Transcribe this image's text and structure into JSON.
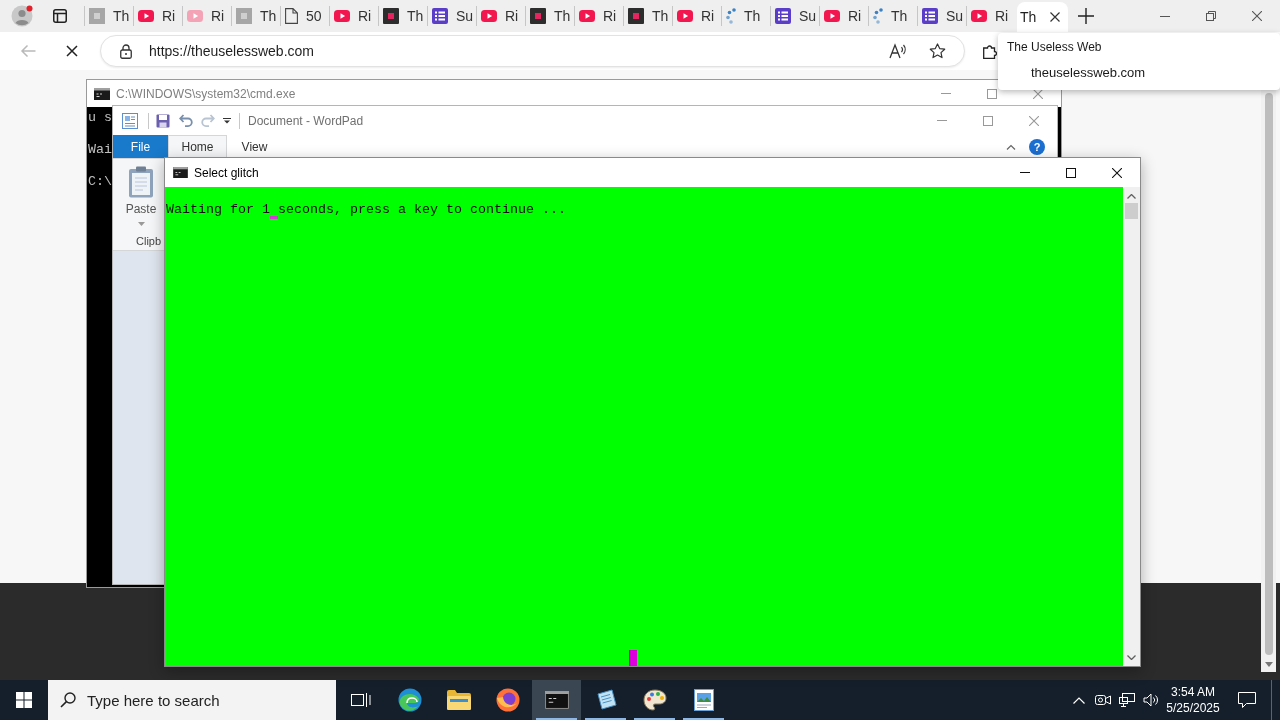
{
  "browser": {
    "tabs": [
      {
        "label": "Th",
        "kind": "grey-tile",
        "selected": false
      },
      {
        "label": "Ri",
        "kind": "play",
        "selected": false
      },
      {
        "label": "Ri",
        "kind": "play-faded",
        "selected": false
      },
      {
        "label": "Th",
        "kind": "grey-tile",
        "selected": false
      },
      {
        "label": "50",
        "kind": "document",
        "selected": false
      },
      {
        "label": "Ri",
        "kind": "play",
        "selected": false
      },
      {
        "label": "Th",
        "kind": "dark-tile",
        "selected": false
      },
      {
        "label": "Su",
        "kind": "list",
        "selected": false
      },
      {
        "label": "Ri",
        "kind": "play",
        "selected": false
      },
      {
        "label": "Th",
        "kind": "dark-tile",
        "selected": false
      },
      {
        "label": "Ri",
        "kind": "play",
        "selected": false
      },
      {
        "label": "Th",
        "kind": "dark-tile",
        "selected": false
      },
      {
        "label": "Ri",
        "kind": "play",
        "selected": false
      },
      {
        "label": "Th",
        "kind": "dots",
        "selected": false
      },
      {
        "label": "Su",
        "kind": "list",
        "selected": false
      },
      {
        "label": "Ri",
        "kind": "play",
        "selected": false
      },
      {
        "label": "Th",
        "kind": "dots",
        "selected": false
      },
      {
        "label": "Su",
        "kind": "list",
        "selected": false
      },
      {
        "label": "Ri",
        "kind": "play",
        "selected": false
      },
      {
        "label": "Th",
        "kind": "blank",
        "selected": true
      }
    ],
    "address_bar": {
      "url": "https://theuselessweb.com"
    },
    "hover_card": {
      "title": "The Useless Web",
      "domain": "theuselessweb.com"
    }
  },
  "cmd_window": {
    "title": "C:\\WINDOWS\\system32\\cmd.exe",
    "lines": [
      "u s",
      "Wai",
      "C:\\"
    ]
  },
  "wordpad_window": {
    "title": "Document - WordPad",
    "ribbon_tabs": [
      {
        "label": "File",
        "kind": "menu",
        "selected": false
      },
      {
        "label": "Home",
        "kind": "tab",
        "selected": true
      },
      {
        "label": "View",
        "kind": "tab",
        "selected": false
      }
    ],
    "paste_button": {
      "label": "Paste"
    },
    "group_label": "Clipb",
    "help_button": {
      "label": "?"
    }
  },
  "glitch_window": {
    "title": "Select glitch",
    "lines": [
      "Waiting for 1 seconds, press a key to continue ..."
    ]
  },
  "taskbar": {
    "search": {
      "placeholder": "Type here to search"
    },
    "apps": [
      {
        "kind": "task-view",
        "running": false,
        "selected": false
      },
      {
        "kind": "swirl",
        "running": false,
        "selected": false
      },
      {
        "kind": "folder",
        "running": false,
        "selected": false
      },
      {
        "kind": "globe",
        "running": false,
        "selected": false
      },
      {
        "kind": "terminal",
        "running": true,
        "selected": true
      },
      {
        "kind": "notepad",
        "running": true,
        "selected": false
      },
      {
        "kind": "palette",
        "running": true,
        "selected": false
      },
      {
        "kind": "picture-document",
        "running": true,
        "selected": false
      }
    ],
    "clock": {
      "time": "3:54 AM",
      "date": "5/25/2025"
    }
  }
}
